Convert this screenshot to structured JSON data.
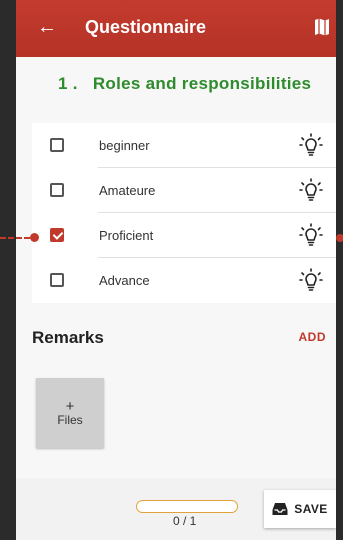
{
  "appbar": {
    "title": "Questionnaire",
    "back_icon": "arrow-left-icon",
    "map_icon": "map-icon",
    "color": "#c0392b"
  },
  "question": {
    "number": "1 .",
    "title": "Roles and responsibilities",
    "color": "#2e8b2e"
  },
  "options": [
    {
      "label": "beginner",
      "checked": false,
      "icon": "lightbulb-icon"
    },
    {
      "label": "Amateure",
      "checked": false,
      "icon": "lightbulb-icon"
    },
    {
      "label": "Proficient",
      "checked": true,
      "icon": "lightbulb-icon"
    },
    {
      "label": "Advance",
      "checked": false,
      "icon": "lightbulb-icon"
    }
  ],
  "remarks": {
    "label": "Remarks",
    "add_label": "ADD",
    "files_plus": "+",
    "files_label": "Files"
  },
  "footer": {
    "progress_text": "0 / 1",
    "progress_value": 0,
    "save_label": "SAVE",
    "save_icon": "inbox-tray-icon"
  }
}
